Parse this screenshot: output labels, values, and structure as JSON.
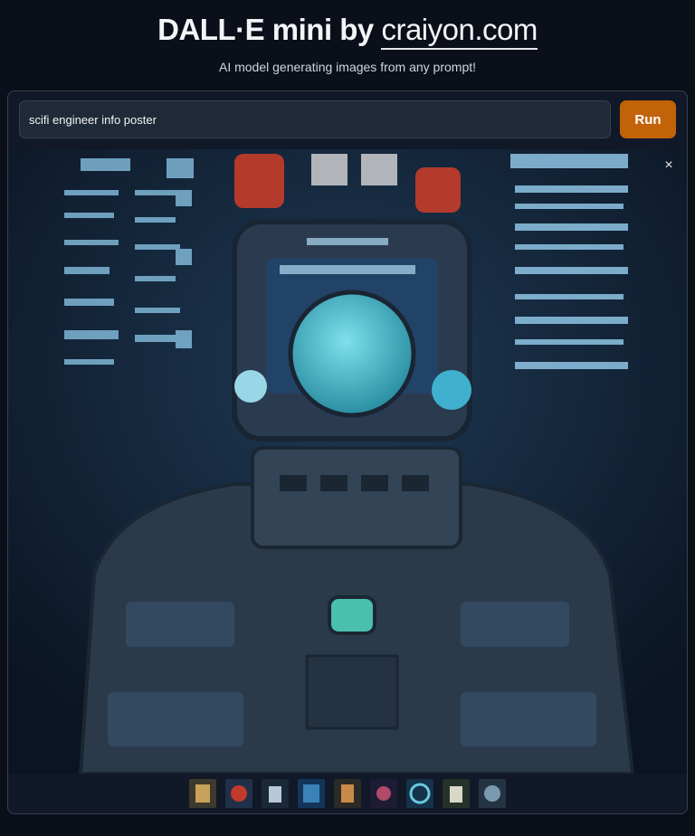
{
  "header": {
    "title_main": "DALL·E mini by ",
    "title_link": "craiyon.com",
    "subtitle": "AI model generating images from any prompt!"
  },
  "prompt": {
    "value": "scifi engineer info poster"
  },
  "run_button": {
    "label": "Run"
  },
  "gallery": {
    "close_label": "×",
    "thumbnail_count": 9
  },
  "colors": {
    "background": "#0b0f19",
    "panel": "#111827",
    "run_button": "#c2630a"
  }
}
